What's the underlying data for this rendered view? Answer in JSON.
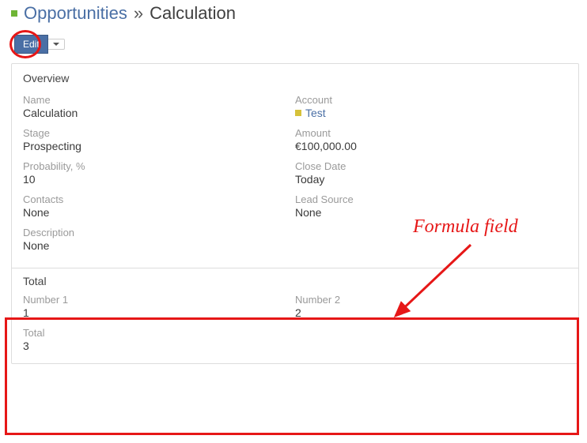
{
  "breadcrumb": {
    "section": "Opportunities",
    "separator": "»",
    "current": "Calculation"
  },
  "buttons": {
    "edit": "Edit"
  },
  "overview": {
    "heading": "Overview",
    "name_label": "Name",
    "name_value": "Calculation",
    "account_label": "Account",
    "account_value": "Test",
    "stage_label": "Stage",
    "stage_value": "Prospecting",
    "amount_label": "Amount",
    "amount_value": "€100,000.00",
    "probability_label": "Probability, %",
    "probability_value": "10",
    "closedate_label": "Close Date",
    "closedate_value": "Today",
    "contacts_label": "Contacts",
    "contacts_value": "None",
    "leadsource_label": "Lead Source",
    "leadsource_value": "None",
    "description_label": "Description",
    "description_value": "None"
  },
  "total": {
    "heading": "Total",
    "number1_label": "Number 1",
    "number1_value": "1",
    "number2_label": "Number 2",
    "number2_value": "2",
    "total_label": "Total",
    "total_value": "3"
  },
  "annotation": "Formula field"
}
